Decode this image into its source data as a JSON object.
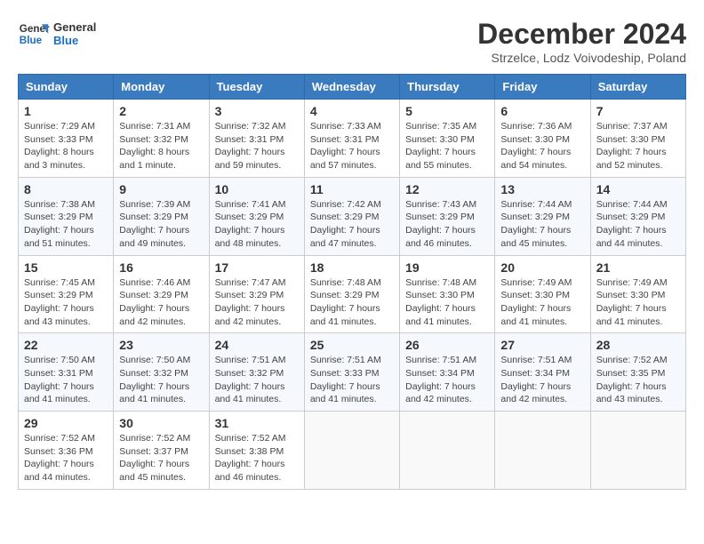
{
  "logo": {
    "line1": "General",
    "line2": "Blue"
  },
  "title": "December 2024",
  "location": "Strzelce, Lodz Voivodeship, Poland",
  "days_of_week": [
    "Sunday",
    "Monday",
    "Tuesday",
    "Wednesday",
    "Thursday",
    "Friday",
    "Saturday"
  ],
  "weeks": [
    [
      {
        "day": "1",
        "info": "Sunrise: 7:29 AM\nSunset: 3:33 PM\nDaylight: 8 hours\nand 3 minutes."
      },
      {
        "day": "2",
        "info": "Sunrise: 7:31 AM\nSunset: 3:32 PM\nDaylight: 8 hours\nand 1 minute."
      },
      {
        "day": "3",
        "info": "Sunrise: 7:32 AM\nSunset: 3:31 PM\nDaylight: 7 hours\nand 59 minutes."
      },
      {
        "day": "4",
        "info": "Sunrise: 7:33 AM\nSunset: 3:31 PM\nDaylight: 7 hours\nand 57 minutes."
      },
      {
        "day": "5",
        "info": "Sunrise: 7:35 AM\nSunset: 3:30 PM\nDaylight: 7 hours\nand 55 minutes."
      },
      {
        "day": "6",
        "info": "Sunrise: 7:36 AM\nSunset: 3:30 PM\nDaylight: 7 hours\nand 54 minutes."
      },
      {
        "day": "7",
        "info": "Sunrise: 7:37 AM\nSunset: 3:30 PM\nDaylight: 7 hours\nand 52 minutes."
      }
    ],
    [
      {
        "day": "8",
        "info": "Sunrise: 7:38 AM\nSunset: 3:29 PM\nDaylight: 7 hours\nand 51 minutes."
      },
      {
        "day": "9",
        "info": "Sunrise: 7:39 AM\nSunset: 3:29 PM\nDaylight: 7 hours\nand 49 minutes."
      },
      {
        "day": "10",
        "info": "Sunrise: 7:41 AM\nSunset: 3:29 PM\nDaylight: 7 hours\nand 48 minutes."
      },
      {
        "day": "11",
        "info": "Sunrise: 7:42 AM\nSunset: 3:29 PM\nDaylight: 7 hours\nand 47 minutes."
      },
      {
        "day": "12",
        "info": "Sunrise: 7:43 AM\nSunset: 3:29 PM\nDaylight: 7 hours\nand 46 minutes."
      },
      {
        "day": "13",
        "info": "Sunrise: 7:44 AM\nSunset: 3:29 PM\nDaylight: 7 hours\nand 45 minutes."
      },
      {
        "day": "14",
        "info": "Sunrise: 7:44 AM\nSunset: 3:29 PM\nDaylight: 7 hours\nand 44 minutes."
      }
    ],
    [
      {
        "day": "15",
        "info": "Sunrise: 7:45 AM\nSunset: 3:29 PM\nDaylight: 7 hours\nand 43 minutes."
      },
      {
        "day": "16",
        "info": "Sunrise: 7:46 AM\nSunset: 3:29 PM\nDaylight: 7 hours\nand 42 minutes."
      },
      {
        "day": "17",
        "info": "Sunrise: 7:47 AM\nSunset: 3:29 PM\nDaylight: 7 hours\nand 42 minutes."
      },
      {
        "day": "18",
        "info": "Sunrise: 7:48 AM\nSunset: 3:29 PM\nDaylight: 7 hours\nand 41 minutes."
      },
      {
        "day": "19",
        "info": "Sunrise: 7:48 AM\nSunset: 3:30 PM\nDaylight: 7 hours\nand 41 minutes."
      },
      {
        "day": "20",
        "info": "Sunrise: 7:49 AM\nSunset: 3:30 PM\nDaylight: 7 hours\nand 41 minutes."
      },
      {
        "day": "21",
        "info": "Sunrise: 7:49 AM\nSunset: 3:30 PM\nDaylight: 7 hours\nand 41 minutes."
      }
    ],
    [
      {
        "day": "22",
        "info": "Sunrise: 7:50 AM\nSunset: 3:31 PM\nDaylight: 7 hours\nand 41 minutes."
      },
      {
        "day": "23",
        "info": "Sunrise: 7:50 AM\nSunset: 3:32 PM\nDaylight: 7 hours\nand 41 minutes."
      },
      {
        "day": "24",
        "info": "Sunrise: 7:51 AM\nSunset: 3:32 PM\nDaylight: 7 hours\nand 41 minutes."
      },
      {
        "day": "25",
        "info": "Sunrise: 7:51 AM\nSunset: 3:33 PM\nDaylight: 7 hours\nand 41 minutes."
      },
      {
        "day": "26",
        "info": "Sunrise: 7:51 AM\nSunset: 3:34 PM\nDaylight: 7 hours\nand 42 minutes."
      },
      {
        "day": "27",
        "info": "Sunrise: 7:51 AM\nSunset: 3:34 PM\nDaylight: 7 hours\nand 42 minutes."
      },
      {
        "day": "28",
        "info": "Sunrise: 7:52 AM\nSunset: 3:35 PM\nDaylight: 7 hours\nand 43 minutes."
      }
    ],
    [
      {
        "day": "29",
        "info": "Sunrise: 7:52 AM\nSunset: 3:36 PM\nDaylight: 7 hours\nand 44 minutes."
      },
      {
        "day": "30",
        "info": "Sunrise: 7:52 AM\nSunset: 3:37 PM\nDaylight: 7 hours\nand 45 minutes."
      },
      {
        "day": "31",
        "info": "Sunrise: 7:52 AM\nSunset: 3:38 PM\nDaylight: 7 hours\nand 46 minutes."
      },
      {
        "day": "",
        "info": ""
      },
      {
        "day": "",
        "info": ""
      },
      {
        "day": "",
        "info": ""
      },
      {
        "day": "",
        "info": ""
      }
    ]
  ]
}
